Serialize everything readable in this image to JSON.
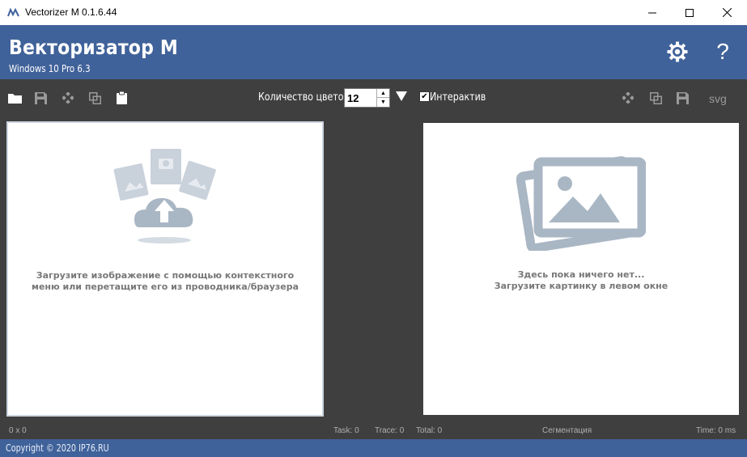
{
  "window": {
    "title": "Vectorizer M 0.1.6.44",
    "controls": {
      "minimize": "—",
      "maximize": "☐",
      "close": "✕"
    }
  },
  "header": {
    "title": "Векторизатор M",
    "subtitle": "Windows 10 Pro 6.3",
    "settings_icon": "gear-icon",
    "help_label": "?"
  },
  "toolbar": {
    "left_icons": [
      "folder-icon",
      "save-icon",
      "sparkle-icon",
      "copy-icon",
      "clipboard-icon"
    ],
    "colors_label": "Количество цветов",
    "colors_value": "12",
    "interactive_label": "Интерактив",
    "interactive_checked": true,
    "right_icons": [
      "sparkle-icon",
      "copy-icon",
      "save-icon"
    ],
    "svg_label": "svg"
  },
  "left_panel": {
    "message_line1": "Загрузите изображение с помощью контекстного",
    "message_line2": "меню или перетащите его из проводника/браузера"
  },
  "right_panel": {
    "message_line1": "Здесь пока ничего нет...",
    "message_line2": "Загрузите картинку в левом окне"
  },
  "status": {
    "size": "0 x 0",
    "task": "Task: 0",
    "trace": "Trace: 0",
    "total": "Total: 0",
    "stage": "Сегментация",
    "time": "Time: 0 ms"
  },
  "footer": {
    "copyright": "Copyright © 2020 IP76.RU"
  },
  "colors": {
    "header_bg": "#40629a",
    "toolbar_bg": "#3f3f3f",
    "placeholder_icon": "#a9b6c4"
  }
}
